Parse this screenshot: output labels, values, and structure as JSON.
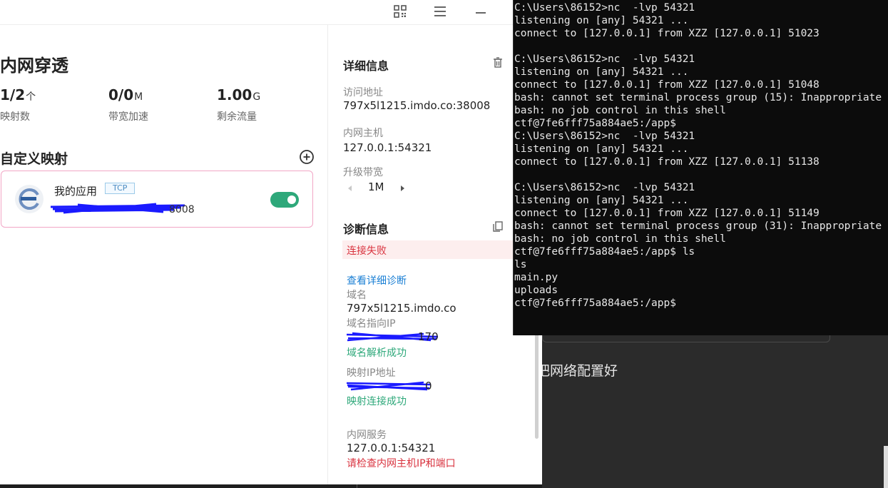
{
  "background": {
    "editor_text": "把网络配置好"
  },
  "app": {
    "titlebar": {
      "icons": [
        "qrcode-icon",
        "menu-icon",
        "minimize-icon"
      ]
    },
    "left": {
      "title": "内网穿透",
      "stats": [
        {
          "value": "1/2",
          "unit": "个",
          "label": "映射数"
        },
        {
          "value": "0/0",
          "unit": "M",
          "label": "带宽加速"
        },
        {
          "value": "1.00",
          "unit": "G",
          "label": "剩余流量"
        }
      ],
      "mapping_section_title": "自定义映射",
      "mapping": {
        "name": "我的应用",
        "protocol": "TCP",
        "address_suffix": "8008",
        "enabled": true
      }
    },
    "right": {
      "details_title": "详细信息",
      "access_label": "访问地址",
      "access_value": "797x5l1215.imdo.co:38008",
      "host_label": "内网主机",
      "host_value": "127.0.0.1:54321",
      "bandwidth_label": "升级带宽",
      "bandwidth_value": "1M",
      "diag_title": "诊断信息",
      "diag_status": "连接失败",
      "diag_link": "查看详细诊断",
      "domain_label": "域名",
      "domain_value": "797x5l1215.imdo.co",
      "domain_ip_label": "域名指向IP",
      "domain_ip_tail": "170",
      "domain_ok": "域名解析成功",
      "map_ip_label": "映射IP地址",
      "map_ip_tail": "0",
      "map_ok": "映射连接成功",
      "service_label": "内网服务",
      "service_value": "127.0.0.1:54321",
      "service_error": "请检查内网主机IP和端口"
    }
  },
  "terminal": {
    "lines": [
      "C:\\Users\\86152>nc  -lvp 54321",
      "listening on [any] 54321 ...",
      "connect to [127.0.0.1] from XZZ [127.0.0.1] 51023",
      "",
      "C:\\Users\\86152>nc  -lvp 54321",
      "listening on [any] 54321 ...",
      "connect to [127.0.0.1] from XZZ [127.0.0.1] 51048",
      "bash: cannot set terminal process group (15): Inappropriate",
      "bash: no job control in this shell",
      "ctf@7fe6fff75a884ae5:/app$",
      "C:\\Users\\86152>nc  -lvp 54321",
      "listening on [any] 54321 ...",
      "connect to [127.0.0.1] from XZZ [127.0.0.1] 51138",
      "",
      "C:\\Users\\86152>nc  -lvp 54321",
      "listening on [any] 54321 ...",
      "connect to [127.0.0.1] from XZZ [127.0.0.1] 51149",
      "bash: cannot set terminal process group (31): Inappropriate",
      "bash: no job control in this shell",
      "ctf@7fe6fff75a884ae5:/app$ ls",
      "ls",
      "main.py",
      "uploads",
      "ctf@7fe6fff75a884ae5:/app$"
    ]
  },
  "colors": {
    "accent_green": "#2ea87a",
    "error_red": "#d9333f",
    "link_blue": "#1a7fd4",
    "card_border": "#f2a6c6",
    "redaction_blue": "#1a1aff"
  }
}
